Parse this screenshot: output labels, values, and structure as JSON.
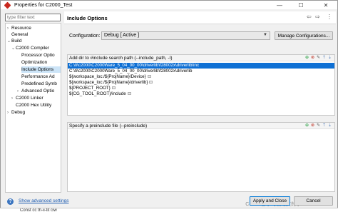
{
  "window": {
    "title": "Properties for C2000_Test",
    "minimize": "—",
    "maximize": "☐",
    "close": "✕"
  },
  "filter": {
    "placeholder": "type filter text"
  },
  "tree": [
    {
      "label": "Resource",
      "twisty": "›"
    },
    {
      "label": "General",
      "twisty": ""
    },
    {
      "label": "Build",
      "twisty": "⌄"
    },
    {
      "label": "C2000 Compiler",
      "twisty": "⌄"
    },
    {
      "label": "Processor Optio",
      "twisty": ""
    },
    {
      "label": "Optimization",
      "twisty": ""
    },
    {
      "label": "Include Options",
      "twisty": ""
    },
    {
      "label": "Performance Ad",
      "twisty": ""
    },
    {
      "label": "Predefined Symb",
      "twisty": ""
    },
    {
      "label": "Advanced Optio",
      "twisty": "›"
    },
    {
      "label": "C2000 Linker",
      "twisty": "›"
    },
    {
      "label": "C2000 Hex Utility",
      "twisty": ""
    },
    {
      "label": "Debug",
      "twisty": "›"
    }
  ],
  "page": {
    "title": "Include Options",
    "nav_back": "⇦",
    "nav_forward": "⇨",
    "nav_menu": "⋮"
  },
  "configuration": {
    "label": "Configuration:",
    "value": "Debug  [ Active ]",
    "manage_button": "Manage Configurations..."
  },
  "include_paths": {
    "header": "Add dir to #include search path (--include_path, -I)",
    "tool_icons": [
      "add-icon",
      "remove-icon",
      "edit-icon",
      "move-up-icon",
      "move-down-icon"
    ],
    "tool_glyphs": [
      "⊕",
      "⊗",
      "✎",
      "⇡",
      "⇣"
    ],
    "tool_colors": [
      "#1e9b3a",
      "#c0392b",
      "#555555",
      "#3d6fb6",
      "#3d6fb6"
    ],
    "items": [
      "C:\\ti\\c2000\\C2000Ware_5_04_00_00\\driverlib\\f28002x\\driverlib\\inc",
      "C:\\ti\\c2000\\C2000Ware_5_04_00_00\\driverlib\\f28002x\\driverlib",
      "${workspace_loc:/${ProjName}/Device}",
      "${workspace_loc:/${ProjName}/driverlib}",
      "${PROJECT_ROOT}",
      "${CG_TOOL_ROOT}/include"
    ]
  },
  "preinclude": {
    "header": "Specify a preinclude file (--preinclude)",
    "tool_icons": [
      "add-icon",
      "remove-icon",
      "edit-icon",
      "move-up-icon",
      "move-down-icon"
    ],
    "tool_glyphs": [
      "⊕",
      "⊗",
      "✎",
      "⇡",
      "⇣"
    ],
    "tool_colors": [
      "#1e9b3a",
      "#c0392b",
      "#555555",
      "#3d6fb6",
      "#3d6fb6"
    ]
  },
  "footer": {
    "help": "?",
    "advanced_link": "Show advanced settings",
    "apply_close": "Apply and Close",
    "cancel": "Cancel",
    "watermark": "CSDN @学习发论文的小MikeZhu",
    "bottom_text": "Const  cc th-ii-tit ciw"
  }
}
